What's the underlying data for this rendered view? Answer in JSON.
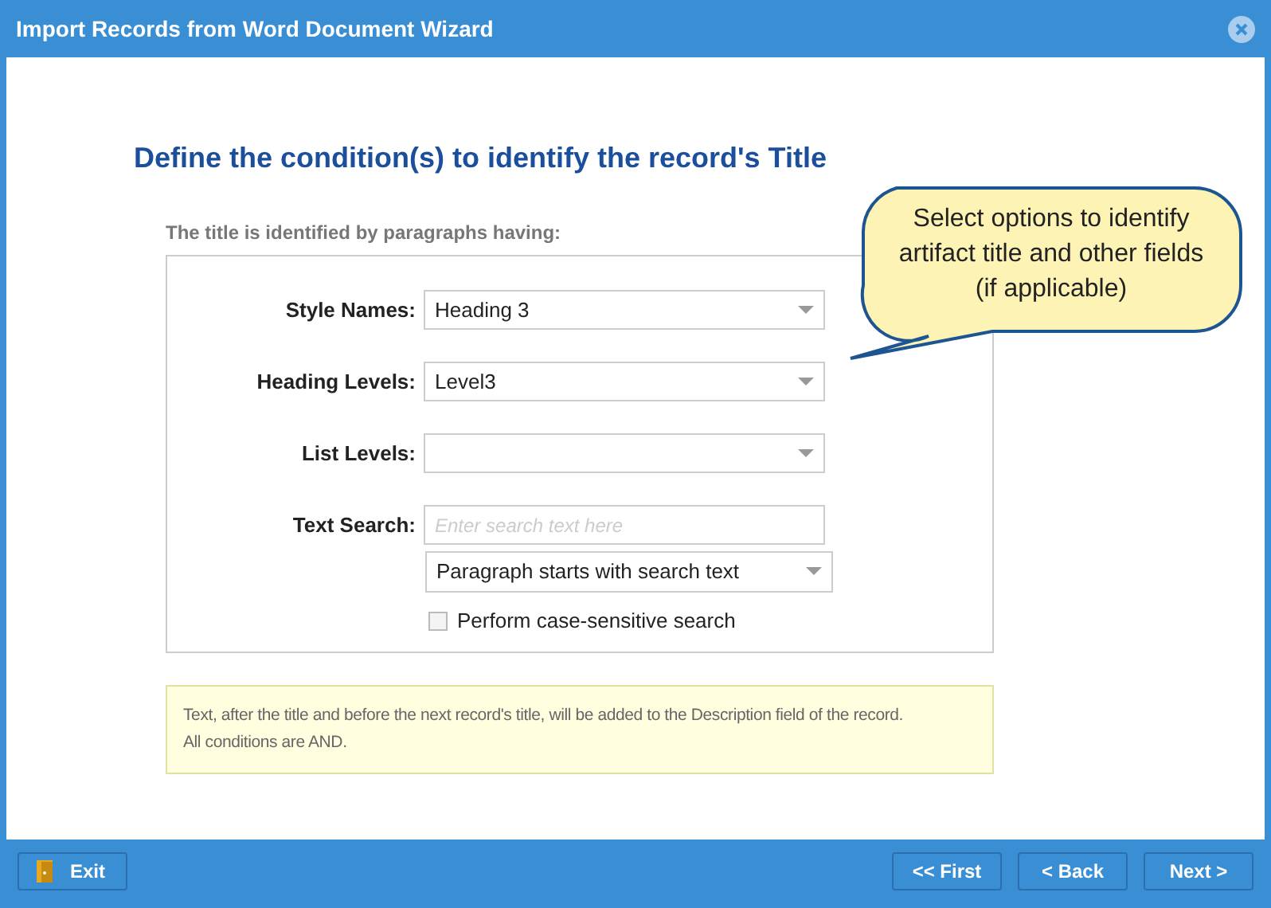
{
  "window": {
    "title": "Import Records from Word Document Wizard"
  },
  "heading": "Define the condition(s) to identify the record's Title",
  "group_label": "The title is identified by paragraphs having:",
  "fields": [
    {
      "kind": "select",
      "label": "Style Names:",
      "value": "Heading 3"
    },
    {
      "kind": "select",
      "label": "Heading Levels:",
      "value": "Level3"
    },
    {
      "kind": "select",
      "label": "List Levels:"
    },
    {
      "kind": "text",
      "label": "Text Search:",
      "placeholder": "Enter search text here"
    }
  ],
  "match_mode": {
    "value": "Paragraph starts with search text"
  },
  "case_sensitive": {
    "label": "Perform case-sensitive search",
    "checked": false
  },
  "note": [
    "Text, after the title and before the next record's title, will be added to the Description field of the record.",
    "All conditions are AND."
  ],
  "callout": "Select options to identify artifact title and other fields (if applicable)",
  "buttons": [
    {
      "kind": "exit",
      "label": "Exit"
    },
    {
      "kind": "nav",
      "label": "<< First"
    },
    {
      "kind": "nav",
      "label": "< Back"
    },
    {
      "kind": "nav",
      "label": "Next >"
    }
  ]
}
